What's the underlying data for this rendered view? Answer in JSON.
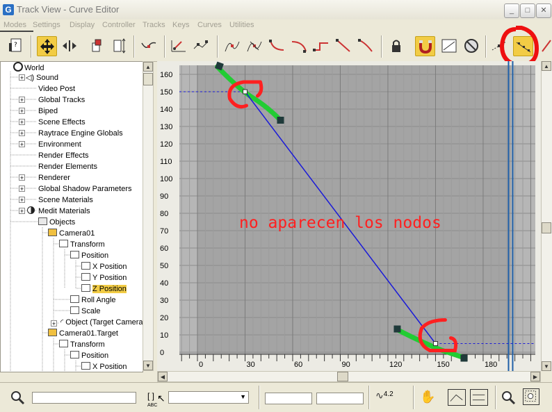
{
  "window": {
    "title": "Track View - Curve Editor",
    "app_icon_glyph": "G",
    "controls": [
      "_",
      "□",
      "✕"
    ]
  },
  "menu": [
    "Modes",
    "Settings",
    "Display",
    "Controller",
    "Tracks",
    "Keys",
    "Curves",
    "Utilities"
  ],
  "tree": {
    "items": [
      {
        "label": "World",
        "icon": "world-icon"
      },
      {
        "label": "Sound",
        "icon": "sound-icon"
      },
      {
        "label": "Video Post",
        "icon": "none"
      },
      {
        "label": "Global Tracks",
        "icon": "none"
      },
      {
        "label": "Biped",
        "icon": "none"
      },
      {
        "label": "Scene Effects",
        "icon": "none"
      },
      {
        "label": "Raytrace Engine Globals",
        "icon": "none"
      },
      {
        "label": "Environment",
        "icon": "none"
      },
      {
        "label": "Render Effects",
        "icon": "none"
      },
      {
        "label": "Render Elements",
        "icon": "none"
      },
      {
        "label": "Renderer",
        "icon": "none"
      },
      {
        "label": "Global Shadow Parameters",
        "icon": "none"
      },
      {
        "label": "Scene Materials",
        "icon": "none"
      },
      {
        "label": "Medit Materials",
        "icon": "material-icon"
      },
      {
        "label": "Objects",
        "icon": "object-cube-icon"
      },
      {
        "label": "Camera01",
        "icon": "camera-cube-icon"
      },
      {
        "label": "Transform",
        "icon": "transform-icon"
      },
      {
        "label": "Position",
        "icon": "position-icon"
      },
      {
        "label": "X Position",
        "icon": "curve-track-icon"
      },
      {
        "label": "Y Position",
        "icon": "curve-track-icon"
      },
      {
        "label": "Z Position",
        "icon": "curve-track-icon"
      },
      {
        "label": "Roll Angle",
        "icon": "roll-icon"
      },
      {
        "label": "Scale",
        "icon": "scale-icon"
      },
      {
        "label": "Object (Target Camera)",
        "icon": "target-camera-icon"
      },
      {
        "label": "Camera01.Target",
        "icon": "camera-cube-icon"
      },
      {
        "label": "Transform",
        "icon": "transform-icon"
      },
      {
        "label": "Position",
        "icon": "position-icon"
      },
      {
        "label": "X Position",
        "icon": "curve-track-icon"
      }
    ],
    "selected": "Z Position"
  },
  "graph": {
    "y_ticks": [
      160,
      150,
      140,
      130,
      120,
      110,
      100,
      90,
      80,
      70,
      60,
      50,
      40,
      30,
      20,
      10,
      0
    ],
    "x_ticks": [
      0,
      30,
      60,
      90,
      120,
      150,
      180
    ],
    "annotation": "no aparecen los nodos",
    "curve": {
      "x": [
        30,
        150
      ],
      "y": [
        150,
        5
      ]
    },
    "colors": {
      "curve": "#1a1ad8",
      "annotation": "#ff2020",
      "highlight": "#22cc33",
      "time_slider": "#2060a8"
    }
  },
  "status": {
    "spinner_value": "4.2",
    "abc_label": "ABC"
  }
}
